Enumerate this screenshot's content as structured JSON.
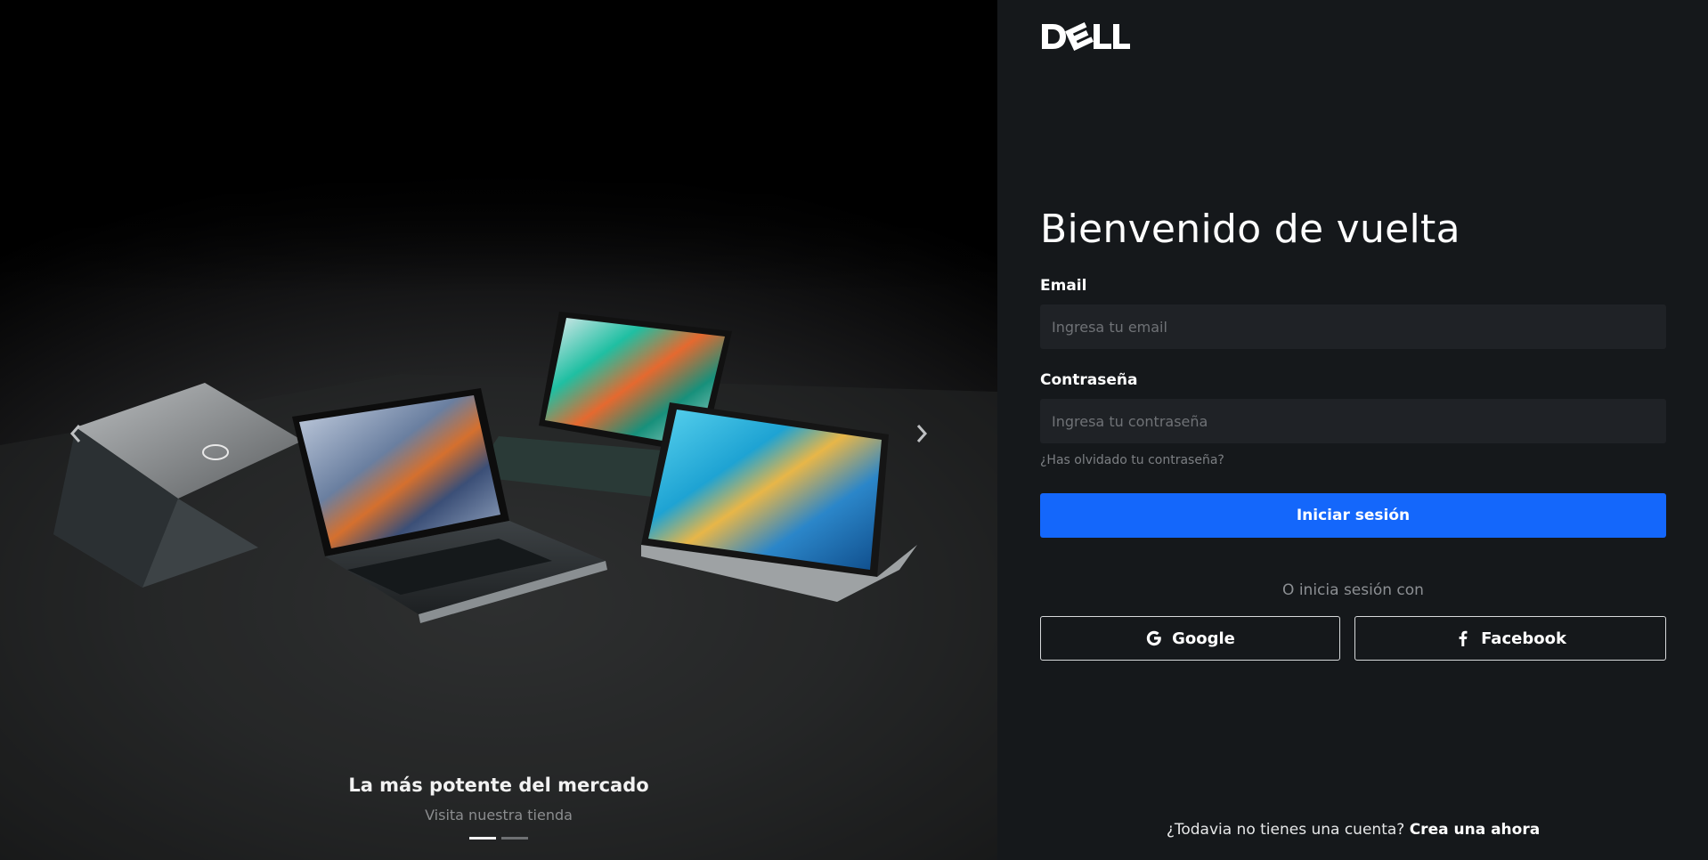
{
  "hero": {
    "title": "La más potente del mercado",
    "subtitle": "Visita nuestra tienda",
    "slides_total": 2,
    "active_slide": 1
  },
  "brand": {
    "logo_text": "DELL"
  },
  "login": {
    "heading": "Bienvenido de vuelta",
    "email_label": "Email",
    "email_placeholder": "Ingresa tu email",
    "password_label": "Contraseña",
    "password_placeholder": "Ingresa tu contraseña",
    "forgot_link": "¿Has olvidado tu contraseña?",
    "submit_label": "Iniciar sesión",
    "divider_text": "O inicia sesión con",
    "google_label": "Google",
    "facebook_label": "Facebook",
    "signup_prompt": "¿Todavia no tienes una cuenta?",
    "signup_link": "Crea una ahora"
  },
  "colors": {
    "primary": "#1467fb",
    "panel_bg": "#15181b",
    "input_bg": "#1f2226"
  },
  "icons": {
    "prev": "chevron-left-icon",
    "next": "chevron-right-icon",
    "google": "google-icon",
    "facebook": "facebook-icon"
  }
}
